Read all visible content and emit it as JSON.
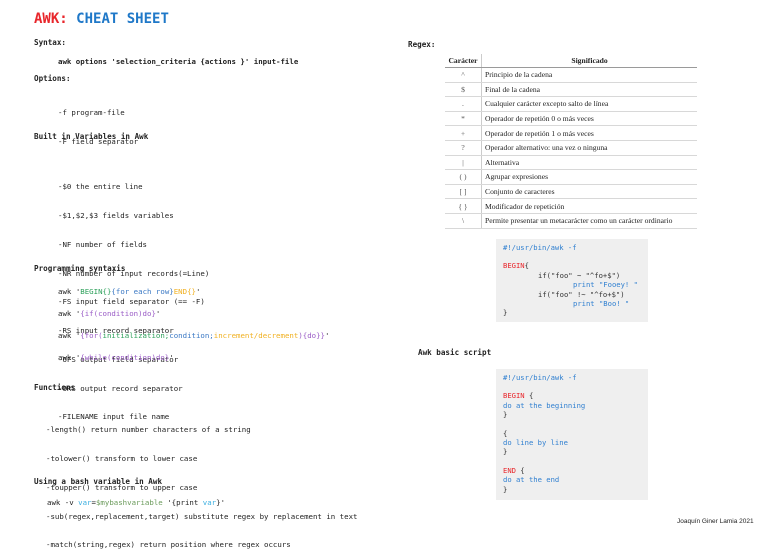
{
  "title": {
    "part1": "AWK:",
    "part2": "CHEAT SHEET"
  },
  "syntax": {
    "heading": "Syntax:",
    "command": "awk options 'selection_criteria {actions }' input-file"
  },
  "options": {
    "heading": "Options:",
    "items": [
      "-f program-file",
      "-F field separator"
    ]
  },
  "builtins": {
    "heading": "Built in Variables in Awk",
    "items": [
      "-$0 the entire line",
      "-$1,$2,$3 fields variables",
      "-NF number of fields",
      "-NR number of input records(=Line)",
      "-FS input field separator (== -F)",
      "-RS input record separator",
      "-OFS output field separator",
      "-ORS output record separator",
      "-FILENAME input file name"
    ]
  },
  "programming": {
    "heading": "Programming syntaxis",
    "lines": [
      [
        {
          "t": "awk ",
          "c": "#222222"
        },
        {
          "t": "'",
          "c": "#222222"
        },
        {
          "t": "BEGIN{}",
          "c": "#2ca05a"
        },
        {
          "t": "{for each row}",
          "c": "#3a78c4"
        },
        {
          "t": "END{}",
          "c": "#f0b020"
        },
        {
          "t": "'",
          "c": "#222222"
        }
      ],
      [
        {
          "t": "awk ",
          "c": "#222222"
        },
        {
          "t": "'",
          "c": "#222222"
        },
        {
          "t": "{if(condition)do}",
          "c": "#9a5cc6"
        },
        {
          "t": "'",
          "c": "#222222"
        }
      ],
      [
        {
          "t": "awk ",
          "c": "#222222"
        },
        {
          "t": "'",
          "c": "#222222"
        },
        {
          "t": "{for(",
          "c": "#9a5cc6"
        },
        {
          "t": "initialization;",
          "c": "#2ca05a"
        },
        {
          "t": "condition;",
          "c": "#3a78c4"
        },
        {
          "t": "increment/decrement",
          "c": "#f0b020"
        },
        {
          "t": "){do}}",
          "c": "#9a5cc6"
        },
        {
          "t": "'",
          "c": "#222222"
        }
      ],
      [
        {
          "t": "awk ",
          "c": "#222222"
        },
        {
          "t": "'",
          "c": "#222222"
        },
        {
          "t": "{while(condition)do}",
          "c": "#9a5cc6"
        },
        {
          "t": "'",
          "c": "#222222"
        }
      ]
    ]
  },
  "functions": {
    "heading": "Functions",
    "items": [
      "-length() return number characters of a string",
      "-tolower() transform to lower case",
      "-toupper() transform to upper case",
      "-sub(regex,replacement,target) substitute regex by replacement in text",
      "-match(string,regex) return position where regex occurs"
    ]
  },
  "bash_var": {
    "heading": "Using a bash variable in Awk",
    "line": [
      {
        "t": "awk -v ",
        "c": "#222222"
      },
      {
        "t": "var",
        "c": "#3aaee0"
      },
      {
        "t": "=",
        "c": "#222222"
      },
      {
        "t": "$mybashvariable",
        "c": "#6a9a5a"
      },
      {
        "t": " '{print ",
        "c": "#222222"
      },
      {
        "t": "var",
        "c": "#3aaee0"
      },
      {
        "t": "}'",
        "c": "#222222"
      }
    ]
  },
  "regex": {
    "heading": "Regex:",
    "columns": [
      "Carácter",
      "Significado"
    ],
    "rows": [
      [
        "^",
        "Principio de la cadena"
      ],
      [
        "$",
        "Final de la cadena"
      ],
      [
        ".",
        "Cualquier carácter excepto salto de línea"
      ],
      [
        "*",
        "Operador de repetión 0 o más veces"
      ],
      [
        "+",
        "Operador de repetión 1 o más veces"
      ],
      [
        "?",
        "Operador alternativo: una vez o ninguna"
      ],
      [
        "|",
        "Alternativa"
      ],
      [
        "( )",
        "Agrupar expresiones"
      ],
      [
        "[ ]",
        "Conjunto de caracteres"
      ],
      [
        "{ }",
        "Modificador de repetición"
      ],
      [
        "\\",
        "Permite presentar un metacarácter como un carácter ordinario"
      ]
    ]
  },
  "regex_example": {
    "shebang": "#!/usr/bin/awk -f",
    "begin": "BEGIN",
    "open": "{",
    "if1": "if(\"foo\" ~ \"^fo+$\")",
    "print1": "print \"Fooey! \"",
    "if2": "if(\"foo\" !~ \"^fo+$\")",
    "print2": "print \"Boo! \"",
    "close": "}"
  },
  "basic_script": {
    "heading": "Awk basic script",
    "shebang": "#!/usr/bin/awk -f",
    "begin": "BEGIN",
    "begin_open": " {",
    "begin_body": " do at the beginning",
    "close": "}",
    "open": "{",
    "body": " do line by line",
    "end": "END",
    "end_open": " {",
    "end_body": " do at the end"
  },
  "footer": "Joaquín Giner Lamia 2021"
}
